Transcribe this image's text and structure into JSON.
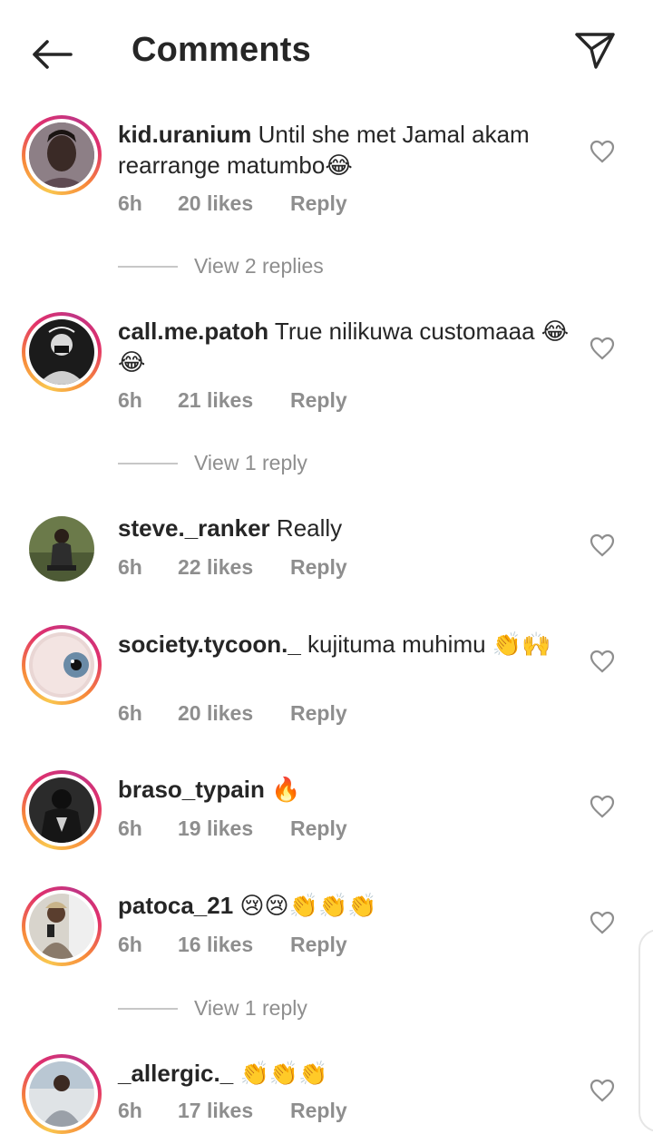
{
  "header": {
    "title": "Comments",
    "back_icon": "arrow-left-icon",
    "share_icon": "paper-plane-icon"
  },
  "comments": [
    {
      "username": "kid.uranium",
      "text": "Until she met Jamal akam rearrange matumbo😂",
      "time": "6h",
      "likes": "20 likes",
      "reply": "Reply",
      "view_replies": "View 2 replies"
    },
    {
      "username": "call.me.patoh",
      "text": "True nilikuwa customaaa 😂😂",
      "time": "6h",
      "likes": "21 likes",
      "reply": "Reply",
      "view_replies": "View 1 reply"
    },
    {
      "username": "steve._ranker",
      "text": "Really",
      "time": "6h",
      "likes": "22 likes",
      "reply": "Reply"
    },
    {
      "username": "society.tycoon._",
      "text": "kujituma muhimu 👏🙌",
      "time": "6h",
      "likes": "20 likes",
      "reply": "Reply"
    },
    {
      "username": "braso_typain",
      "text": "🔥",
      "time": "6h",
      "likes": "19 likes",
      "reply": "Reply"
    },
    {
      "username": "patoca_21",
      "text": "😢😢👏👏👏",
      "time": "6h",
      "likes": "16 likes",
      "reply": "Reply",
      "view_replies": "View 1 reply"
    },
    {
      "username": "_allergic._",
      "text": "👏👏👏",
      "time": "6h",
      "likes": "17 likes",
      "reply": "Reply"
    }
  ],
  "colors": {
    "text": "#262626",
    "muted": "#8e8e8e",
    "story_ring_start": "#f9c74f",
    "story_ring_end": "#c13584"
  }
}
